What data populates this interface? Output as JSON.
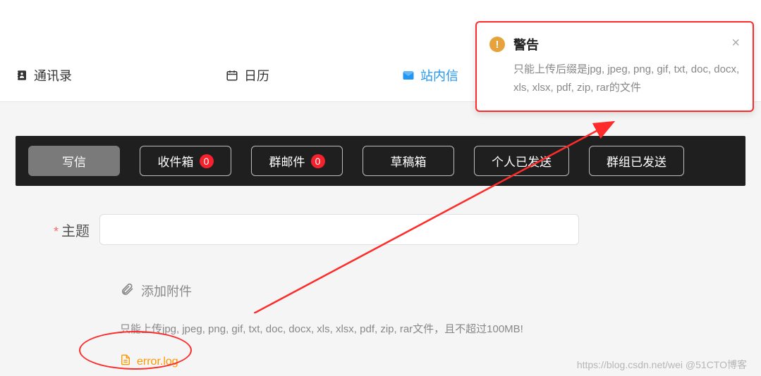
{
  "nav": {
    "contacts": "通讯录",
    "calendar": "日历",
    "site_msg": "站内信"
  },
  "tabs": {
    "compose": "写信",
    "inbox": {
      "label": "收件箱",
      "count": 0
    },
    "group_mail": {
      "label": "群邮件",
      "count": 0
    },
    "drafts": "草稿箱",
    "personal_sent": "个人已发送",
    "group_sent": "群组已发送"
  },
  "form": {
    "subject_label": "主题",
    "attach_label": "添加附件",
    "hint": "只能上传jpg, jpeg, png, gif, txt, doc, docx, xls, xlsx, pdf, zip, rar文件，且不超过100MB!",
    "file_name": "error.log"
  },
  "toast": {
    "title": "警告",
    "body": "只能上传后缀是jpg, jpeg, png, gif, txt, doc, docx, xls, xlsx, pdf, zip, rar的文件"
  },
  "watermark": "https://blog.csdn.net/wei @51CTO博客"
}
